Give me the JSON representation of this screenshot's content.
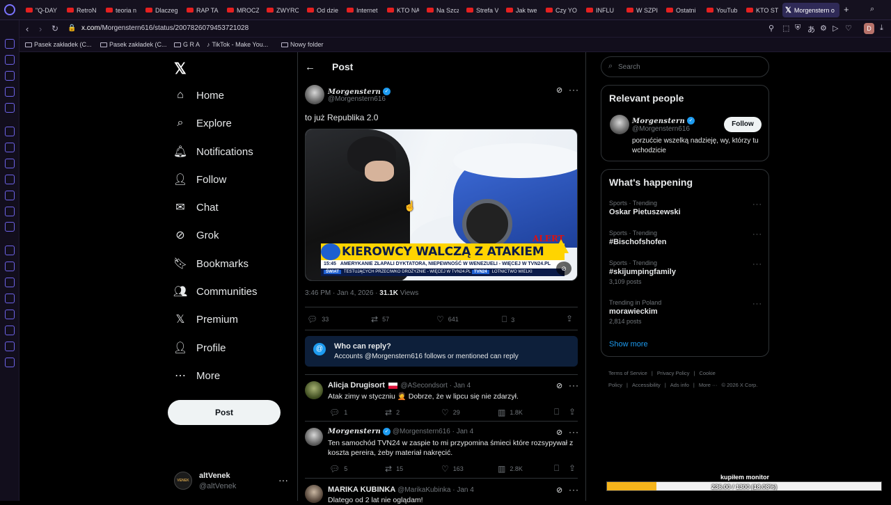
{
  "browser": {
    "tabs": [
      "\"Q-DAY",
      "RetroN",
      "teoria n",
      "Dlaczeg",
      "RAP TA",
      "MROCZ",
      "ZWYRO",
      "Od dzie",
      "Internet",
      "KTO NA",
      "Na Szcz",
      "Strefa V",
      "Jak twe",
      "Czy YO",
      "INFLU",
      "W SZPI",
      "Ostatni",
      "YouTub",
      "KTO ST",
      "Morgenstern o"
    ],
    "url_host": "x.com",
    "url_path": "/Morgenstern616/status/2007826079453721028",
    "profile_letter": "D",
    "bookmarks": [
      "Pasek zakładek (C...",
      "Pasek zakładek (C...",
      "G R A",
      "TikTok - Make You...",
      "Nowy folder"
    ]
  },
  "nav": {
    "items": [
      "Home",
      "Explore",
      "Notifications",
      "Follow",
      "Chat",
      "Grok",
      "Bookmarks",
      "Communities",
      "Premium",
      "Profile",
      "More"
    ],
    "post_button": "Post",
    "account_name": "altVenek",
    "account_handle": "@altVenek",
    "account_avatar_text": "VENEK"
  },
  "header": {
    "title": "Post"
  },
  "post": {
    "author": "Morgenstern",
    "handle": "@Morgenstern616",
    "text": "to już Republika 2.0",
    "media": {
      "headline": "KIEROWCY WALCZĄ Z ATAKIEM ZIMY",
      "ticker_time": "15:45",
      "ticker_text": "AMERYKANIE ZŁAPALI DYKTATORA, NIEPEWNOŚĆ W WENEZUELI - WIĘCEJ W TVN24.PL",
      "ticker_tag": "ŚWIAT",
      "ticker_text2": "TESTUJĄCYCH PRZECIWKO DROŻYZNIE - WIĘCEJ W TVN24.PL",
      "ticker_tag2": "TVN24",
      "ticker_text3": "LOTNICTWO WIELKI",
      "alert": "ALERT"
    },
    "time": "3:46 PM · Jan 4, 2026 · ",
    "views_count": "31.1K",
    "views_label": " Views",
    "replies": "33",
    "reposts": "57",
    "likes": "641",
    "bookmarks": "3"
  },
  "who_can_reply": {
    "title": "Who can reply?",
    "text": "Accounts @Morgenstern616 follows or mentioned can reply"
  },
  "replies": [
    {
      "name": "Alicja Drugisort",
      "handle": "@ASecondsort",
      "date": "· Jan 4",
      "text": "Atak zimy w styczniu 🤦 Dobrze, że w lipcu się nie zdarzył.",
      "replies": "1",
      "reposts": "2",
      "likes": "29",
      "views": "1.8K"
    },
    {
      "name": "Morgenstern",
      "handle": "@Morgenstern616",
      "date": "· Jan 4",
      "text": "Ten samochód TVN24 w zaspie to mi przypomina śmieci które rozsypywał z koszta pereira, żeby materiał nakręcić.",
      "replies": "5",
      "reposts": "15",
      "likes": "163",
      "views": "2.8K"
    },
    {
      "name": "MARIKA KUBINKA",
      "handle": "@MarikaKubinka",
      "date": "· Jan 4",
      "text": "Dlatego od 2 lat nie oglądam!"
    }
  ],
  "right": {
    "search_placeholder": "Search",
    "relevant_title": "Relevant people",
    "rp_name": "Morgenstern",
    "rp_handle": "@Morgenstern616",
    "rp_follow": "Follow",
    "rp_bio": "porzućcie wszelką nadzieję, wy, którzy tu wchodzicie",
    "happening_title": "What's happening",
    "trends": [
      {
        "category": "Sports · Trending",
        "name": "Oskar Pietuszewski",
        "posts": ""
      },
      {
        "category": "Sports · Trending",
        "name": "#Bischofshofen",
        "posts": ""
      },
      {
        "category": "Sports · Trending",
        "name": "#skijumpingfamily",
        "posts": "3,109 posts"
      },
      {
        "category": "Trending in Poland",
        "name": "morawieckim",
        "posts": "2,814 posts"
      }
    ],
    "show_more": "Show more",
    "footer": [
      "Terms of Service",
      "|",
      "Privacy Policy",
      "|",
      "Cookie Policy",
      "|",
      "Accessibility",
      "|",
      "Ads info",
      "|",
      "More ···",
      "© 2026 X Corp."
    ]
  },
  "overlay": {
    "label": "kupiłem monitor",
    "progress_text": "236.00 / 1300 (18.08%)",
    "progress_fraction": 0.1808,
    "fill_color": "#f5b41b"
  }
}
